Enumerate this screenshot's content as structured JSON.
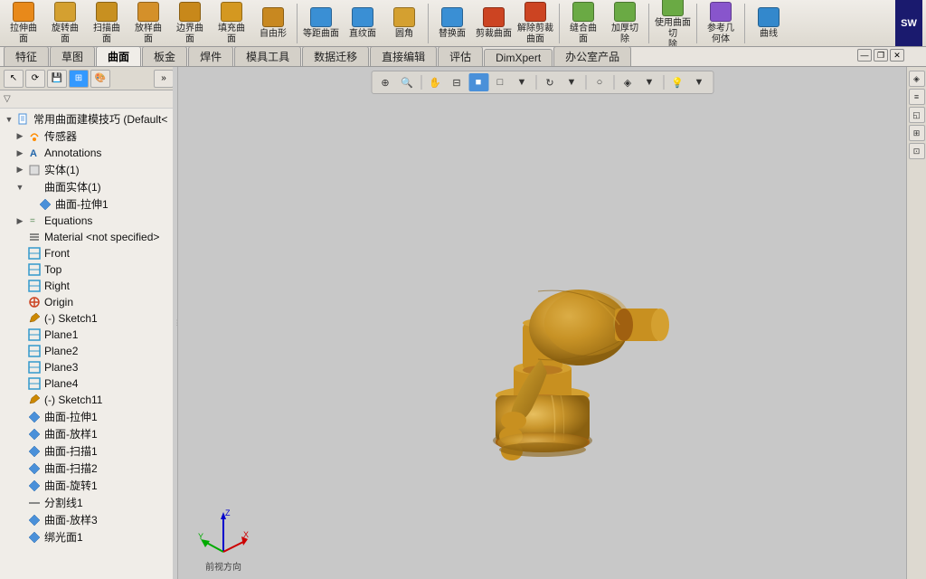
{
  "app": {
    "brand": "SW",
    "title": "常用曲面建模技巧 (Default<"
  },
  "top_toolbar": {
    "groups": [
      {
        "id": "stretch-surface",
        "label": "拉伸曲\n面",
        "icon_color": "#b87a20"
      },
      {
        "id": "rotate-surface",
        "label": "旋转曲\n面",
        "icon_color": "#b87a20"
      },
      {
        "id": "scan-surface",
        "label": "扫描曲\n面",
        "icon_color": "#b87a20"
      },
      {
        "id": "loft-surface",
        "label": "放样曲\n面",
        "icon_color": "#b87a20"
      },
      {
        "id": "edge-surface",
        "label": "边界曲\n面",
        "icon_color": "#b87a20"
      },
      {
        "id": "fill-surface",
        "label": "填充曲\n面",
        "icon_color": "#b87a20"
      },
      {
        "id": "freeform",
        "label": "自由形",
        "icon_color": "#b87a20"
      },
      {
        "id": "equal-dist-surface",
        "label": "等距曲面",
        "icon_color": "#b87a20"
      },
      {
        "id": "straight-surface",
        "label": "直纹面",
        "icon_color": "#b87a20"
      },
      {
        "id": "circle",
        "label": "圆角",
        "icon_color": "#b87a20"
      },
      {
        "id": "replace-surface",
        "label": "替换面",
        "icon_color": "#b87a20"
      },
      {
        "id": "cut-surface",
        "label": "剪裁曲面",
        "icon_color": "#b87a20"
      },
      {
        "id": "remove-cut",
        "label": "解除剪裁\n曲面",
        "icon_color": "#b87a20"
      },
      {
        "id": "merge-surface",
        "label": "缝合曲\n面",
        "icon_color": "#b87a20"
      },
      {
        "id": "thicken-cut",
        "label": "加厚切\n除",
        "icon_color": "#b87a20"
      },
      {
        "id": "curve-surface-cut",
        "label": "使用曲面切\n除",
        "icon_color": "#b87a20"
      },
      {
        "id": "reference",
        "label": "参考几\n何体",
        "icon_color": "#b87a20"
      },
      {
        "id": "curve",
        "label": "曲线",
        "icon_color": "#b87a20"
      }
    ]
  },
  "tabs": {
    "items": [
      {
        "id": "feature",
        "label": "特征",
        "active": false
      },
      {
        "id": "sketch",
        "label": "草图",
        "active": false
      },
      {
        "id": "surface",
        "label": "曲面",
        "active": true
      },
      {
        "id": "sheet",
        "label": "板金",
        "active": false
      },
      {
        "id": "weld",
        "label": "焊件",
        "active": false
      },
      {
        "id": "mold",
        "label": "模具工具",
        "active": false
      },
      {
        "id": "data-transfer",
        "label": "数据迁移",
        "active": false
      },
      {
        "id": "direct-edit",
        "label": "直接编辑",
        "active": false
      },
      {
        "id": "evaluate",
        "label": "评估",
        "active": false
      },
      {
        "id": "dimxpert",
        "label": "DimXpert",
        "active": false
      },
      {
        "id": "office",
        "label": "办公室产品",
        "active": false
      }
    ]
  },
  "left_panel": {
    "toolbar_buttons": [
      "arrow",
      "rotate",
      "save",
      "grid",
      "color",
      "more"
    ],
    "title": "常用曲面建模技巧 (Default<",
    "tree_items": [
      {
        "id": "root",
        "label": "常用曲面建模技巧 (Default<",
        "indent": 0,
        "expand": "▼",
        "icon": "📄"
      },
      {
        "id": "sensors",
        "label": "传感器",
        "indent": 1,
        "expand": "▶",
        "icon": "📡"
      },
      {
        "id": "annotations",
        "label": "Annotations",
        "indent": 1,
        "expand": "▶",
        "icon": "A"
      },
      {
        "id": "solid1",
        "label": "实体(1)",
        "indent": 1,
        "expand": "▶",
        "icon": "⬜"
      },
      {
        "id": "surface-solid1",
        "label": "曲面实体(1)",
        "indent": 1,
        "expand": "▼",
        "icon": "◇"
      },
      {
        "id": "surface-stretch1",
        "label": "曲面-拉伸1",
        "indent": 2,
        "expand": "",
        "icon": "◆"
      },
      {
        "id": "equations",
        "label": "Equations",
        "indent": 1,
        "expand": "▶",
        "icon": "="
      },
      {
        "id": "material",
        "label": "Material <not specified>",
        "indent": 1,
        "expand": "",
        "icon": "≡"
      },
      {
        "id": "front",
        "label": "Front",
        "indent": 1,
        "expand": "",
        "icon": "◫"
      },
      {
        "id": "top",
        "label": "Top",
        "indent": 1,
        "expand": "",
        "icon": "◫"
      },
      {
        "id": "right",
        "label": "Right",
        "indent": 1,
        "expand": "",
        "icon": "◫"
      },
      {
        "id": "origin",
        "label": "Origin",
        "indent": 1,
        "expand": "",
        "icon": "⊕"
      },
      {
        "id": "sketch1",
        "label": "(-) Sketch1",
        "indent": 1,
        "expand": "",
        "icon": "✏"
      },
      {
        "id": "plane1",
        "label": "Plane1",
        "indent": 1,
        "expand": "",
        "icon": "◫"
      },
      {
        "id": "plane2",
        "label": "Plane2",
        "indent": 1,
        "expand": "",
        "icon": "◫"
      },
      {
        "id": "plane3",
        "label": "Plane3",
        "indent": 1,
        "expand": "",
        "icon": "◫"
      },
      {
        "id": "plane4",
        "label": "Plane4",
        "indent": 1,
        "expand": "",
        "icon": "◫"
      },
      {
        "id": "sketch11",
        "label": "(-) Sketch11",
        "indent": 1,
        "expand": "",
        "icon": "✏"
      },
      {
        "id": "surface-stretch-2",
        "label": "曲面-拉伸1",
        "indent": 1,
        "expand": "",
        "icon": "◆"
      },
      {
        "id": "surface-loft1",
        "label": "曲面-放样1",
        "indent": 1,
        "expand": "",
        "icon": "◆"
      },
      {
        "id": "surface-scan1",
        "label": "曲面-扫描1",
        "indent": 1,
        "expand": "",
        "icon": "◆"
      },
      {
        "id": "surface-scan2",
        "label": "曲面-扫描2",
        "indent": 1,
        "expand": "",
        "icon": "◆"
      },
      {
        "id": "surface-rotate1",
        "label": "曲面-旋转1",
        "indent": 1,
        "expand": "",
        "icon": "◆"
      },
      {
        "id": "split-line1",
        "label": "分割线1",
        "indent": 1,
        "expand": "",
        "icon": "—"
      },
      {
        "id": "surface-loft2",
        "label": "曲面-放样3",
        "indent": 1,
        "expand": "",
        "icon": "◆"
      },
      {
        "id": "surface-more",
        "label": "绑光面1",
        "indent": 1,
        "expand": "",
        "icon": "◆"
      }
    ]
  },
  "viewport": {
    "toolbar_buttons": [
      {
        "id": "zoom-in",
        "icon": "🔍+"
      },
      {
        "id": "zoom-out",
        "icon": "🔍-"
      },
      {
        "id": "view-orient",
        "icon": "⟳"
      },
      {
        "id": "section",
        "icon": "⊟"
      },
      {
        "id": "display-mode",
        "icon": "◉"
      },
      {
        "id": "shaded",
        "icon": "▣"
      },
      {
        "id": "rotate",
        "icon": "↻"
      },
      {
        "id": "more1",
        "icon": "⋯"
      },
      {
        "id": "sphere",
        "icon": "⚬"
      },
      {
        "id": "color1",
        "icon": "🎨"
      },
      {
        "id": "more2",
        "icon": "⋯"
      },
      {
        "id": "lighting",
        "icon": "💡"
      },
      {
        "id": "more3",
        "icon": "⋯"
      }
    ]
  },
  "axis_indicator": {
    "label": "前视方向"
  },
  "window_controls": {
    "minimize": "—",
    "restore": "❐",
    "close": "✕"
  },
  "right_panel_buttons": [
    "◈",
    "≡",
    "◱",
    "⊞",
    "⊡"
  ]
}
